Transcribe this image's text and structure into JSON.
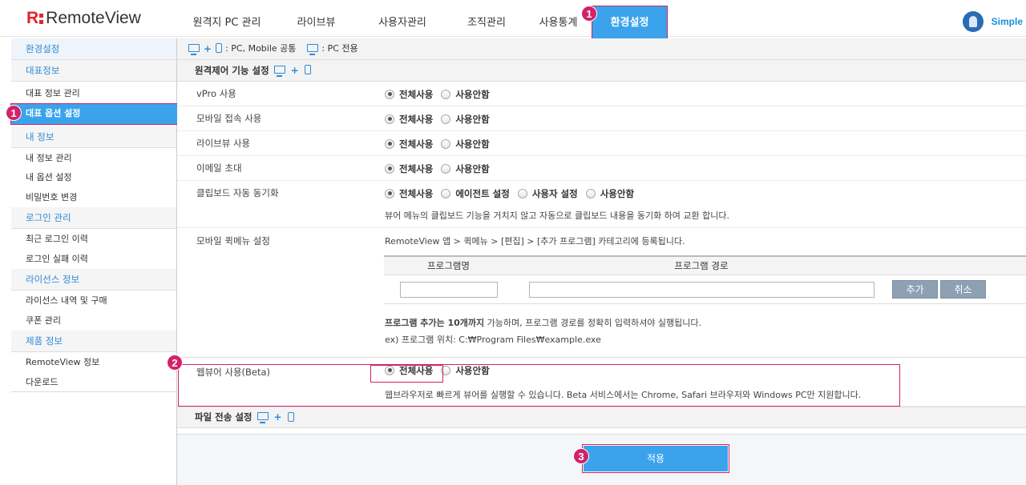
{
  "brand": {
    "logo_r": "R",
    "logo_name": "RemoteView"
  },
  "nav": {
    "items": [
      "원격지 PC 관리",
      "라이브뷰",
      "사용자관리",
      "조직관리",
      "사용통계",
      "환경설정"
    ],
    "active_index": 5
  },
  "user": {
    "name": "Simple"
  },
  "markers": {
    "one": "1",
    "two": "2",
    "three": "3"
  },
  "sidebar": {
    "head": "환경설정",
    "sections": [
      {
        "title": "대표정보",
        "items": [
          "대표 정보 관리",
          "대표 옵션 설정"
        ]
      },
      {
        "title": "내 정보",
        "items": [
          "내 정보 관리",
          "내 옵션 설정",
          "비밀번호 변경"
        ]
      },
      {
        "title": "로그인 관리",
        "items": [
          "최근 로그인 이력",
          "로그인 실패 이력"
        ]
      },
      {
        "title": "라이선스 정보",
        "items": [
          "라이선스 내역 및 구매",
          "쿠폰 관리"
        ]
      },
      {
        "title": "제품 정보",
        "items": [
          "RemoteView 정보",
          "다운로드"
        ]
      }
    ],
    "selected": "대표 옵션 설정"
  },
  "legend": {
    "common": ": PC, Mobile 공통",
    "pc_only": ": PC 전용"
  },
  "remote_section": {
    "title": "원격제어 기능 설정"
  },
  "rows": {
    "vpro": {
      "label": "vPro 사용"
    },
    "mobile": {
      "label": "모바일 접속 사용"
    },
    "liveview": {
      "label": "라이브뷰 사용"
    },
    "email": {
      "label": "이메일 초대"
    },
    "clipboard": {
      "label": "클립보드 자동 동기화",
      "desc": "뷰어 메뉴의 클립보드 기능을 거치지 않고 자동으로 클립보드 내용을 동기화 하여 교환 합니다."
    },
    "quickmenu": {
      "label": "모바일 퀵메뉴 설정",
      "desc": "RemoteView 앱 > 퀵메뉴 > [편집] > [추가 프로그램] 카테고리에 등록됩니다."
    },
    "webviewer": {
      "label": "웹뷰어 사용(Beta)",
      "desc": "웹브라우저로 빠르게 뷰어를 실행할 수 있습니다. Beta 서비스에서는 Chrome, Safari 브라우저와 Windows PC만 지원합니다."
    }
  },
  "options": {
    "all_use": "전체사용",
    "not_use": "사용안함",
    "agent": "에이전트 설정",
    "user_setting": "사용자 설정"
  },
  "program_table": {
    "col_name": "프로그램명",
    "col_path": "프로그램 경로",
    "add": "추가",
    "cancel": "취소",
    "name_value": "",
    "path_value": "",
    "note_bold": "프로그램 추가는 10개까지",
    "note_rest": " 가능하며, 프로그램 경로를 정확히 입력하셔야 실행됩니다.",
    "example": "ex) 프로그램 위치: C:₩Program Files₩example.exe"
  },
  "file_section": {
    "title": "파일 전송 설정"
  },
  "apply_button": "적용"
}
